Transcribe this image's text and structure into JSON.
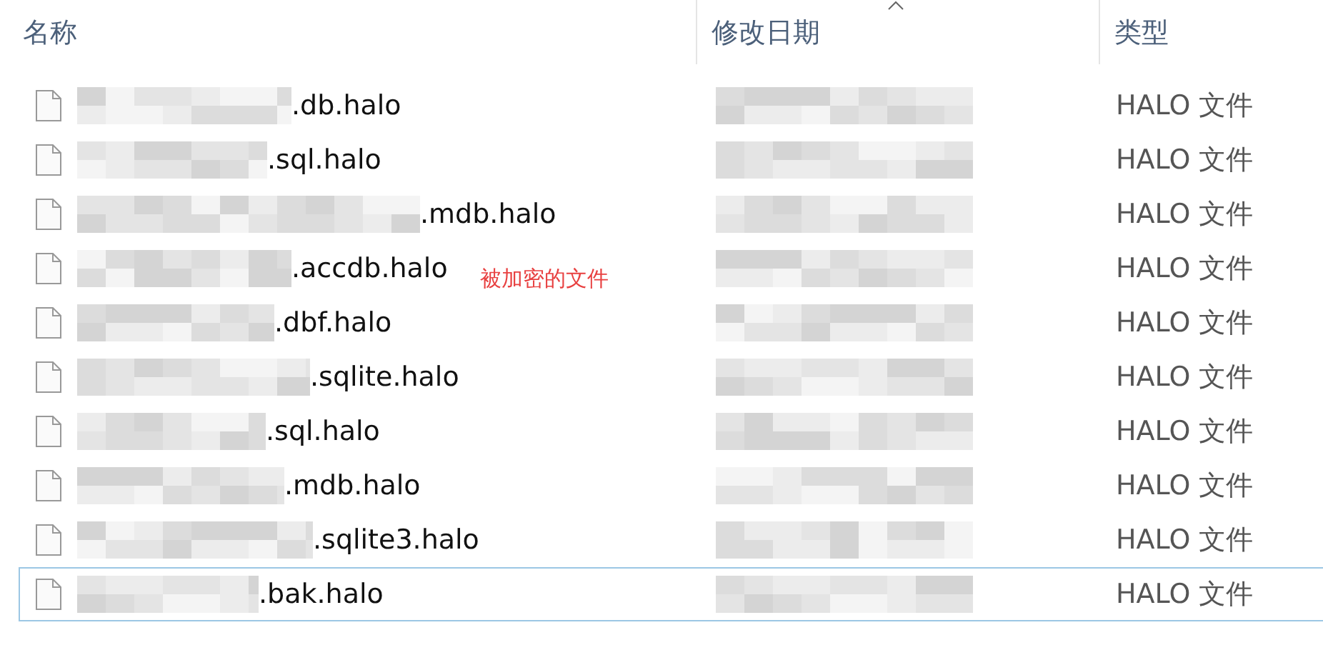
{
  "columns": [
    {
      "label": "名称",
      "sorted": false
    },
    {
      "label": "修改日期",
      "sorted": true
    },
    {
      "label": "类型",
      "sorted": false
    }
  ],
  "files": [
    {
      "name": ".db.halo",
      "type": "HALO 文件",
      "focused": false
    },
    {
      "name": ".sql.halo",
      "type": "HALO 文件",
      "focused": false
    },
    {
      "name": ".mdb.halo",
      "type": "HALO 文件",
      "focused": false
    },
    {
      "name": ".accdb.halo",
      "type": "HALO 文件",
      "focused": false
    },
    {
      "name": ".dbf.halo",
      "type": "HALO 文件",
      "focused": false
    },
    {
      "name": ".sqlite.halo",
      "type": "HALO 文件",
      "focused": false
    },
    {
      "name": ".sql.halo",
      "type": "HALO 文件",
      "focused": false
    },
    {
      "name": ".mdb.halo",
      "type": "HALO 文件",
      "focused": false
    },
    {
      "name": ".sqlite3.halo",
      "type": "HALO 文件",
      "focused": false
    },
    {
      "name": ".bak.halo",
      "type": "HALO 文件",
      "focused": true
    }
  ],
  "annotation": "被加密的文件"
}
